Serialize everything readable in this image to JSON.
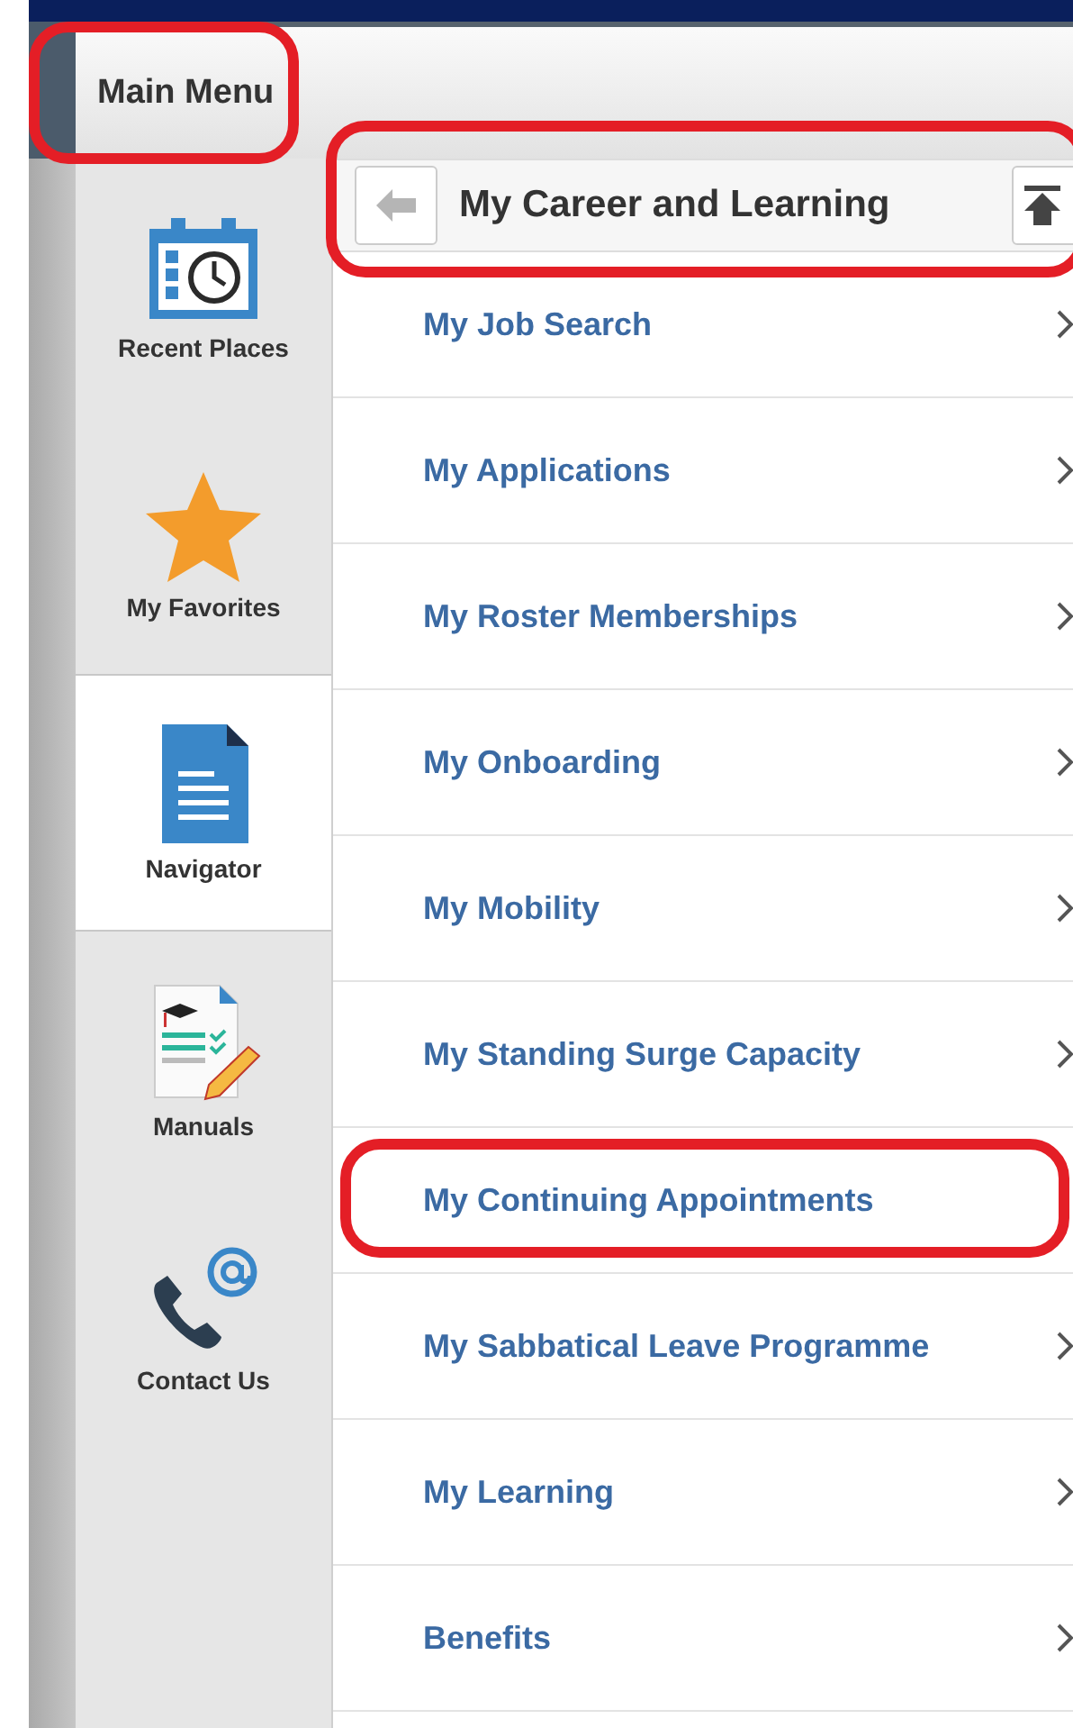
{
  "header": {
    "title": "Main Menu",
    "highlighted": true
  },
  "sidebar": {
    "items": [
      {
        "label": "Recent Places",
        "kind": "recent",
        "selected": false
      },
      {
        "label": "My Favorites",
        "kind": "favorites",
        "selected": false
      },
      {
        "label": "Navigator",
        "kind": "navigator",
        "selected": true
      },
      {
        "label": "Manuals",
        "kind": "manuals",
        "selected": false
      },
      {
        "label": "Contact Us",
        "kind": "contact",
        "selected": false
      }
    ]
  },
  "breadcrumb": {
    "title": "My Career and Learning",
    "highlighted": true
  },
  "menu": {
    "items": [
      {
        "label": "My Job Search",
        "highlighted": false
      },
      {
        "label": "My Applications",
        "highlighted": false
      },
      {
        "label": "My Roster Memberships",
        "highlighted": false
      },
      {
        "label": "My Onboarding",
        "highlighted": false
      },
      {
        "label": "My Mobility",
        "highlighted": false
      },
      {
        "label": "My Standing Surge Capacity",
        "highlighted": false
      },
      {
        "label": "My Continuing Appointments",
        "highlighted": true
      },
      {
        "label": "My Sabbatical Leave Programme",
        "highlighted": false
      },
      {
        "label": "My Learning",
        "highlighted": false
      },
      {
        "label": "Benefits",
        "highlighted": false
      }
    ]
  }
}
